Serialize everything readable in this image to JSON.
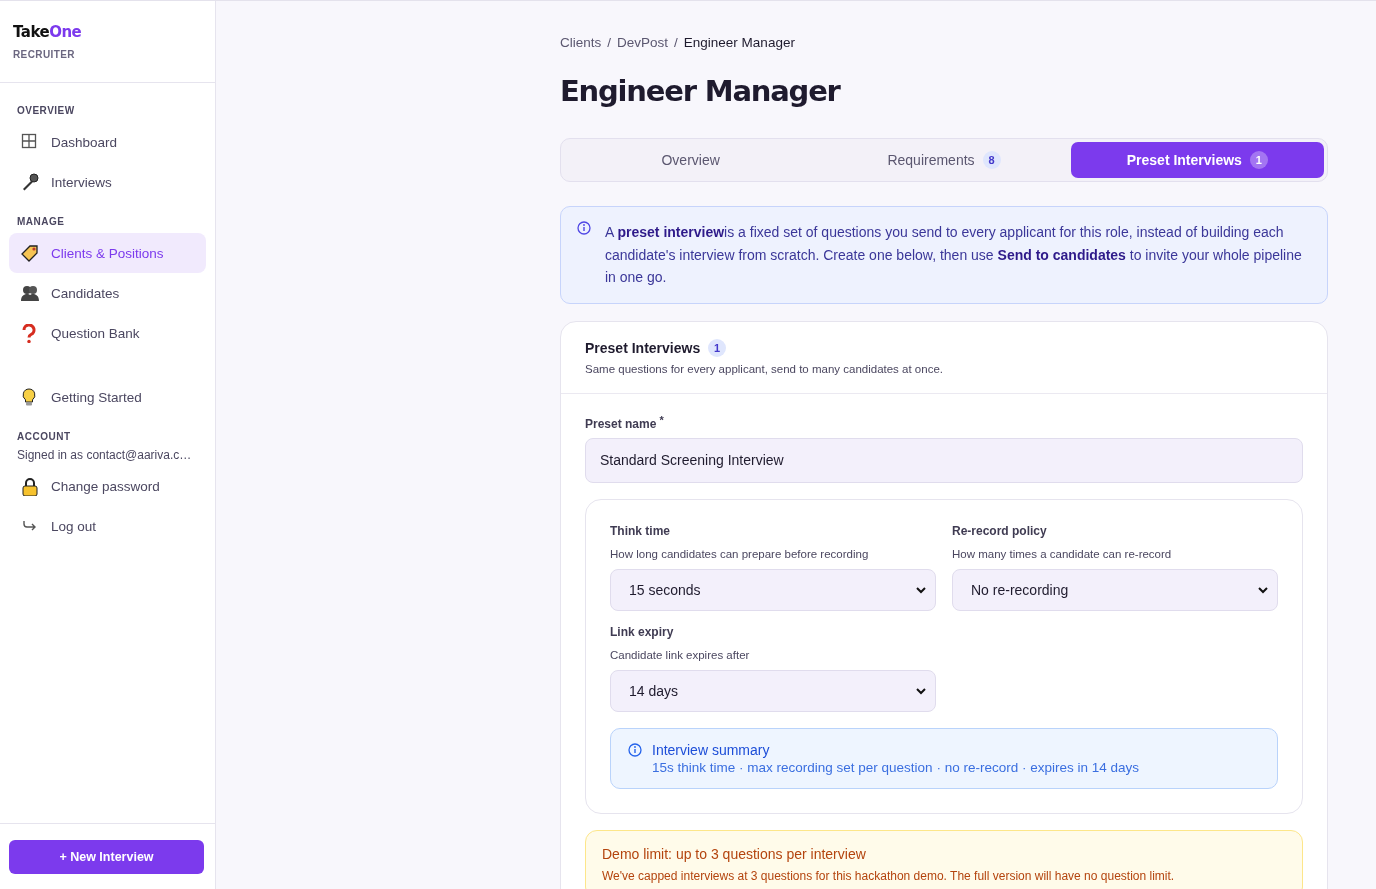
{
  "sidebar": {
    "logo": [
      "Take",
      "One"
    ],
    "subtitle": "RECRUITER",
    "sections": [
      {
        "heading": "OVERVIEW",
        "items": [
          {
            "label": "Dashboard",
            "selected": false
          },
          {
            "label": "Interviews",
            "selected": false
          }
        ]
      },
      {
        "heading": "MANAGE",
        "items": [
          {
            "label": "Clients & Positions",
            "selected": true
          },
          {
            "label": "Candidates",
            "selected": false
          },
          {
            "label": "Question Bank",
            "selected": false
          }
        ]
      },
      {
        "items": [
          {
            "label": "Getting Started",
            "selected": false
          }
        ]
      },
      {
        "heading": "ACCOUNT",
        "note": "Signed in as contact@aariva.c…",
        "items": [
          {
            "label": "Change password",
            "selected": false
          },
          {
            "label": "Log out",
            "selected": false
          }
        ]
      }
    ],
    "button": "+ New Interview"
  },
  "breadcrumb": [
    {
      "kind": "link",
      "text": "Clients"
    },
    {
      "kind": "separator",
      "text": "/"
    },
    {
      "kind": "link",
      "text": "DevPost"
    },
    {
      "kind": "separator",
      "text": "/"
    },
    {
      "kind": "current",
      "text": "Engineer Manager"
    }
  ],
  "title": "Engineer Manager",
  "tabs": [
    {
      "label": "Overview",
      "selected": false
    },
    {
      "label": "Requirements",
      "count": "8",
      "selected": false
    },
    {
      "label": "Preset Interviews",
      "count": "1",
      "selected": true
    }
  ],
  "notice": "A **preset interview**is a fixed set of questions you send to every applicant for this role, instead of building each candidate's interview from scratch. Create one below, then use **Send to candidates** to invite your whole pipeline in one go.",
  "preset_card": {
    "title": "Preset Interviews",
    "count": "1",
    "subtitle": "Same questions for every applicant, send to many candidates at once.",
    "name_field": {
      "label": "Preset name",
      "required_mark": "*",
      "value": "Standard Screening Interview"
    },
    "settings": [
      {
        "label": "Think time",
        "hint": "How long candidates can prepare before recording",
        "value": "15 seconds"
      },
      {
        "label": "Re-record policy",
        "hint": "How many times a candidate can re-record",
        "value": "No re-recording"
      },
      {
        "label": "Link expiry",
        "hint": "Candidate link expires after",
        "value": "14 days"
      }
    ],
    "summary": {
      "title": "Interview summary",
      "text": "15s think time · max recording set per question · no re-record · expires in 14 days"
    },
    "demo_limit": {
      "title": "Demo limit: up to 3 questions per interview",
      "text": "We've capped interviews at 3 questions for this hackathon demo. The full version will have no question limit."
    }
  }
}
